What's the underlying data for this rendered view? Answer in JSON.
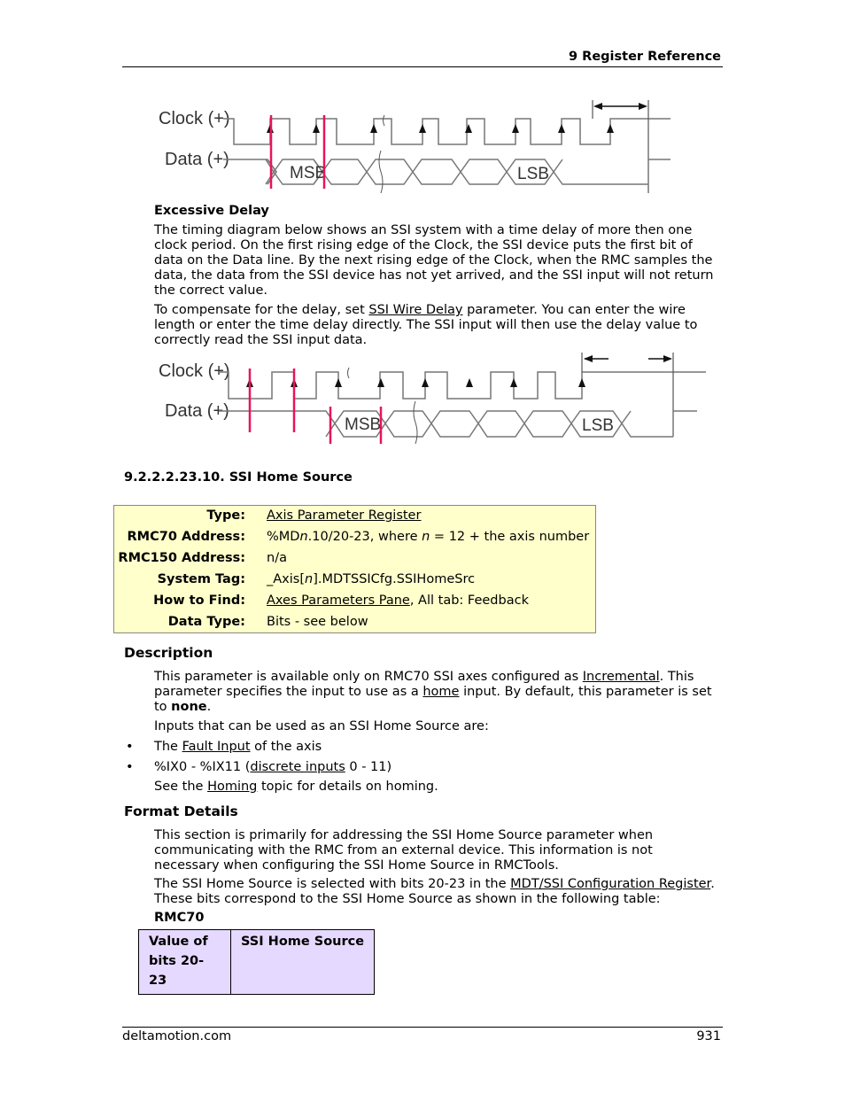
{
  "header": {
    "title": "9  Register Reference"
  },
  "diagram1": {
    "clock_label": "Clock (+)",
    "data_label": "Data (+)",
    "msb_label": "MSB",
    "lsb_label": "LSB"
  },
  "excessive_delay": {
    "heading": "Excessive Delay",
    "para1": "The timing diagram below shows an SSI system with a time delay of more then one clock period. On the first rising edge of the Clock, the SSI device puts the first bit of data on the Data line. By the next rising edge of the Clock, when the RMC samples the data, the data from the SSI device has not yet arrived, and the SSI input will not return the correct value.",
    "para2_pre": "To compensate for the delay, set ",
    "para2_link": "SSI Wire Delay",
    "para2_post": " parameter. You can enter the wire length or enter the time delay directly. The SSI input will then use the delay value to correctly read the SSI input data."
  },
  "diagram2": {
    "clock_label": "Clock (+)",
    "data_label": "Data (+)",
    "msb_label": "MSB",
    "lsb_label": "LSB"
  },
  "section": {
    "title": "9.2.2.2.23.10. SSI Home Source"
  },
  "info": {
    "type_key": "Type:",
    "type_val": "Axis Parameter Register",
    "rmc70_key": "RMC70 Address:",
    "rmc70_val_a": "%MD",
    "rmc70_val_n": "n",
    "rmc70_val_b": ".10/20-23, where ",
    "rmc70_val_n2": "n",
    "rmc70_val_c": " = 12 + the axis number",
    "rmc150_key": "RMC150 Address:",
    "rmc150_val": "n/a",
    "tag_key": "System Tag:",
    "tag_val_a": "_Axis[",
    "tag_val_n": "n",
    "tag_val_b": "].MDTSSICfg.SSIHomeSrc",
    "find_key": "How to Find:",
    "find_link": "Axes Parameters Pane",
    "find_post": ", All tab: Feedback",
    "dtype_key": "Data Type:",
    "dtype_val": "Bits - see below"
  },
  "description": {
    "heading": "Description",
    "p1_a": "This parameter is available only on RMC70 SSI axes configured as ",
    "p1_link1": "Incremental",
    "p1_b": ". This parameter specifies the input to use as a ",
    "p1_link2": "home",
    "p1_c": " input. By default, this parameter is set to ",
    "p1_bold": "none",
    "p1_d": ".",
    "p2": "Inputs that can be used as an SSI Home Source are:",
    "bullets": [
      {
        "pre": "The ",
        "link": "Fault Input",
        "post": " of the axis"
      },
      {
        "pre": "%IX0 - %IX11 (",
        "link": "discrete inputs",
        "post": " 0 - 11)"
      }
    ],
    "p3_pre": "See the ",
    "p3_link": "Homing",
    "p3_post": " topic for details on homing."
  },
  "format": {
    "heading": "Format Details",
    "p1": "This section is primarily for addressing the SSI Home Source parameter when communicating with the RMC from an external device. This information is not necessary when configuring the SSI Home Source in RMCTools.",
    "p2_pre": "The SSI Home Source is selected with bits 20-23 in the ",
    "p2_link": "MDT/SSI Configuration Register",
    "p2_post": ". These bits correspond to the SSI Home Source as shown in the following table:",
    "table_label": "RMC70",
    "table_headers": [
      "Value of bits 20-23",
      "SSI Home Source"
    ]
  },
  "footer": {
    "left": "deltamotion.com",
    "right": "931"
  },
  "colors": {
    "info_box_bg": "#ffffcc",
    "table_header_bg": "#e6d9ff",
    "marker_red": "#e8145a"
  }
}
